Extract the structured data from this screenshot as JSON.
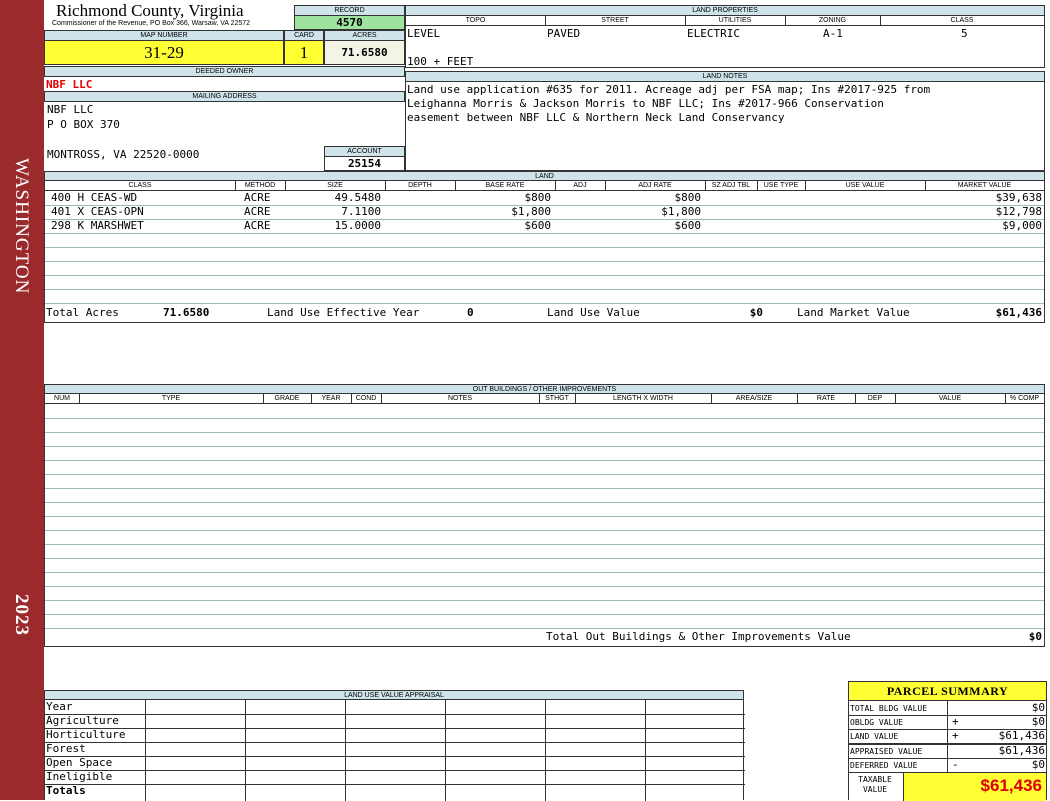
{
  "sidebar": {
    "county": "WASHINGTON",
    "year": "2023"
  },
  "header": {
    "title": "Richmond County, Virginia",
    "subtitle": "Commissioner of the Revenue, PO Box 366, Warsaw, VA 22572"
  },
  "record": {
    "label": "RECORD",
    "value": "4570"
  },
  "map": {
    "label": "MAP NUMBER",
    "value": "31-29",
    "card_label": "CARD",
    "card": "1",
    "acres_label": "ACRES",
    "acres": "71.6580"
  },
  "owner": {
    "deeded_label": "DEEDED OWNER",
    "deeded": "NBF LLC",
    "mailing_label": "MAILING ADDRESS",
    "line1": "NBF LLC",
    "line2": "P O BOX 370",
    "line3": "MONTROSS, VA 22520-0000",
    "account_label": "ACCOUNT",
    "account": "25154"
  },
  "land_properties": {
    "label": "LAND PROPERTIES",
    "headers": [
      "TOPO",
      "STREET",
      "UTILITIES",
      "ZONING",
      "CLASS"
    ],
    "values": [
      "LEVEL",
      "PAVED",
      "ELECTRIC",
      "A-1",
      "5"
    ],
    "frontage": "100 + FEET"
  },
  "land_notes": {
    "label": "LAND NOTES",
    "line1": "Land use application #635 for 2011. Acreage adj per FSA map; Ins #2017-925 from",
    "line2": "Leighanna Morris & Jackson Morris to NBF LLC; Ins #2017-966 Conservation",
    "line3": "easement between NBF LLC & Northern Neck Land Conservancy"
  },
  "land": {
    "label": "LAND",
    "headers": [
      "CLASS",
      "METHOD",
      "SIZE",
      "DEPTH",
      "BASE RATE",
      "ADJ",
      "ADJ RATE",
      "SZ ADJ TBL",
      "USE TYPE",
      "USE VALUE",
      "MARKET VALUE"
    ],
    "rows": [
      {
        "cls": "400 H CEAS-WD",
        "method": "ACRE",
        "size": "49.5480",
        "base": "$800",
        "adj_rate": "$800",
        "market": "$39,638"
      },
      {
        "cls": "401 X CEAS-OPN",
        "method": "ACRE",
        "size": "7.1100",
        "base": "$1,800",
        "adj_rate": "$1,800",
        "market": "$12,798"
      },
      {
        "cls": "298 K MARSHWET",
        "method": "ACRE",
        "size": "15.0000",
        "base": "$600",
        "adj_rate": "$600",
        "market": "$9,000"
      }
    ],
    "total_acres_label": "Total Acres",
    "total_acres": "71.6580",
    "use_year_label": "Land Use Effective Year",
    "use_year": "0",
    "use_value_label": "Land Use Value",
    "use_value": "$0",
    "market_label": "Land Market Value",
    "market": "$61,436"
  },
  "outbuildings": {
    "label": "OUT BUILDINGS / OTHER IMPROVEMENTS",
    "headers": [
      "NUM",
      "TYPE",
      "GRADE",
      "YEAR",
      "COND",
      "NOTES",
      "STHGT",
      "LENGTH X WIDTH",
      "AREA/SIZE",
      "RATE",
      "DEP",
      "VALUE",
      "% COMP"
    ],
    "total_label": "Total Out Buildings & Other Improvements Value",
    "total": "$0"
  },
  "land_use_appraisal": {
    "label": "LAND USE VALUE APPRAISAL",
    "rows": [
      "Year",
      "Agriculture",
      "Horticulture",
      "Forest",
      "Open Space",
      "Ineligible",
      "Totals"
    ]
  },
  "summary": {
    "title": "PARCEL SUMMARY",
    "rows": [
      {
        "label": "TOTAL BLDG VALUE",
        "op": "",
        "value": "$0"
      },
      {
        "label": "OBLDG VALUE",
        "op": "+",
        "value": "$0"
      },
      {
        "label": "LAND VALUE",
        "op": "+",
        "value": "$61,436"
      },
      {
        "label": "APPRAISED VALUE",
        "op": "",
        "value": "$61,436"
      },
      {
        "label": "DEFERRED VALUE",
        "op": "-",
        "value": "$0"
      }
    ],
    "taxable_label": "TAXABLE VALUE",
    "taxable": "$61,436"
  },
  "colors": {
    "sidebar": "#9b2a2d",
    "header_bg": "#cfe4ea",
    "yellow": "#ffff33",
    "green": "#9ee39e",
    "red": "#e00000"
  }
}
